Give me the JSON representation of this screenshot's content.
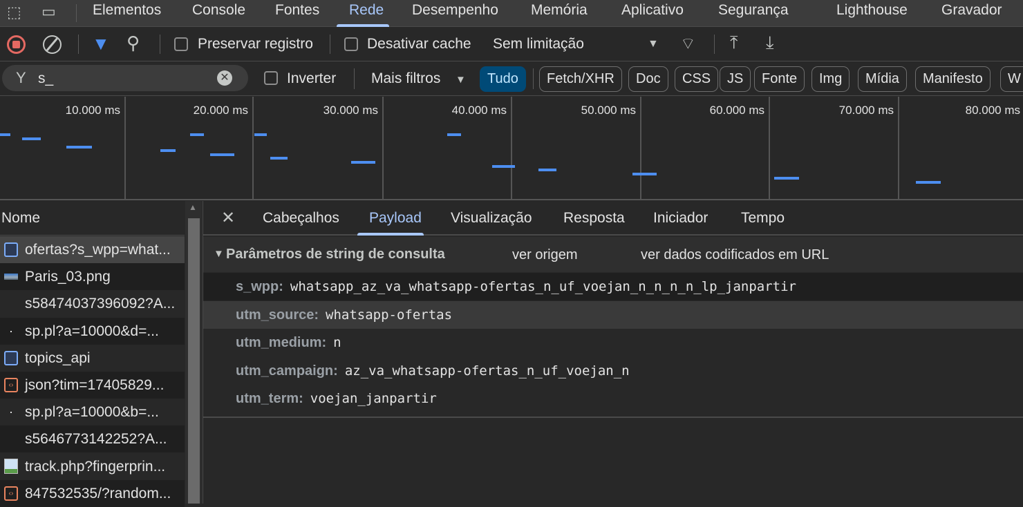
{
  "tabs": [
    {
      "label": "Elementos"
    },
    {
      "label": "Console"
    },
    {
      "label": "Fontes"
    },
    {
      "label": "Rede",
      "active": true
    },
    {
      "label": "Desempenho"
    },
    {
      "label": "Memória"
    },
    {
      "label": "Aplicativo"
    },
    {
      "label": "Segurança"
    },
    {
      "label": "Lighthouse"
    },
    {
      "label": "Gravador"
    }
  ],
  "toolbar": {
    "preserve_log": "Preservar registro",
    "disable_cache": "Desativar cache",
    "throttling": "Sem limitação"
  },
  "filter": {
    "value": "s_",
    "invert": "Inverter",
    "more_filters": "Mais filtros",
    "types": [
      "Tudo",
      "Fetch/XHR",
      "Doc",
      "CSS",
      "JS",
      "Fonte",
      "Img",
      "Mídia",
      "Manifesto",
      "W"
    ]
  },
  "timeline": {
    "ticks": [
      "10.000 ms",
      "20.000 ms",
      "30.000 ms",
      "40.000 ms",
      "50.000 ms",
      "60.000 ms",
      "70.000 ms",
      "80.000 ms"
    ]
  },
  "requests": {
    "header": "Nome",
    "items": [
      {
        "name": "ofertas?s_wpp=what...",
        "icon": "document-icon"
      },
      {
        "name": "Paris_03.png",
        "icon": "image-thumbnail-icon"
      },
      {
        "name": "s58474037396092?A...",
        "icon": ""
      },
      {
        "name": "sp.pl?a=10000&d=...",
        "icon": "dot-icon"
      },
      {
        "name": "topics_api",
        "icon": "document-icon"
      },
      {
        "name": "json?tim=17405829...",
        "icon": "script-icon"
      },
      {
        "name": "sp.pl?a=10000&b=...",
        "icon": "dot-icon"
      },
      {
        "name": "s5646773142252?A...",
        "icon": ""
      },
      {
        "name": "track.php?fingerprin...",
        "icon": "image-icon"
      },
      {
        "name": "847532535/?random...",
        "icon": "script-icon"
      }
    ]
  },
  "detail": {
    "tabs": [
      "Cabeçalhos",
      "Payload",
      "Visualização",
      "Resposta",
      "Iniciador",
      "Tempo"
    ],
    "active_tab": "Payload",
    "section_title": "Parâmetros de string de consulta",
    "view_source": "ver origem",
    "view_url_encoded": "ver dados codificados em URL",
    "params": [
      {
        "key": "s_wpp:",
        "value": "whatsapp_az_va_whatsapp-ofertas_n_uf_voejan_n_n_n_n_lp_janpartir"
      },
      {
        "key": "utm_source:",
        "value": "whatsapp-ofertas"
      },
      {
        "key": "utm_medium:",
        "value": "n"
      },
      {
        "key": "utm_campaign:",
        "value": "az_va_whatsapp-ofertas_n_uf_voejan_n"
      },
      {
        "key": "utm_term:",
        "value": "voejan_janpartir"
      }
    ]
  },
  "colors": {
    "accent": "#a8c7fa",
    "record": "#e46962",
    "filter_active": "#004a77",
    "bar": "#4d8ef0"
  }
}
